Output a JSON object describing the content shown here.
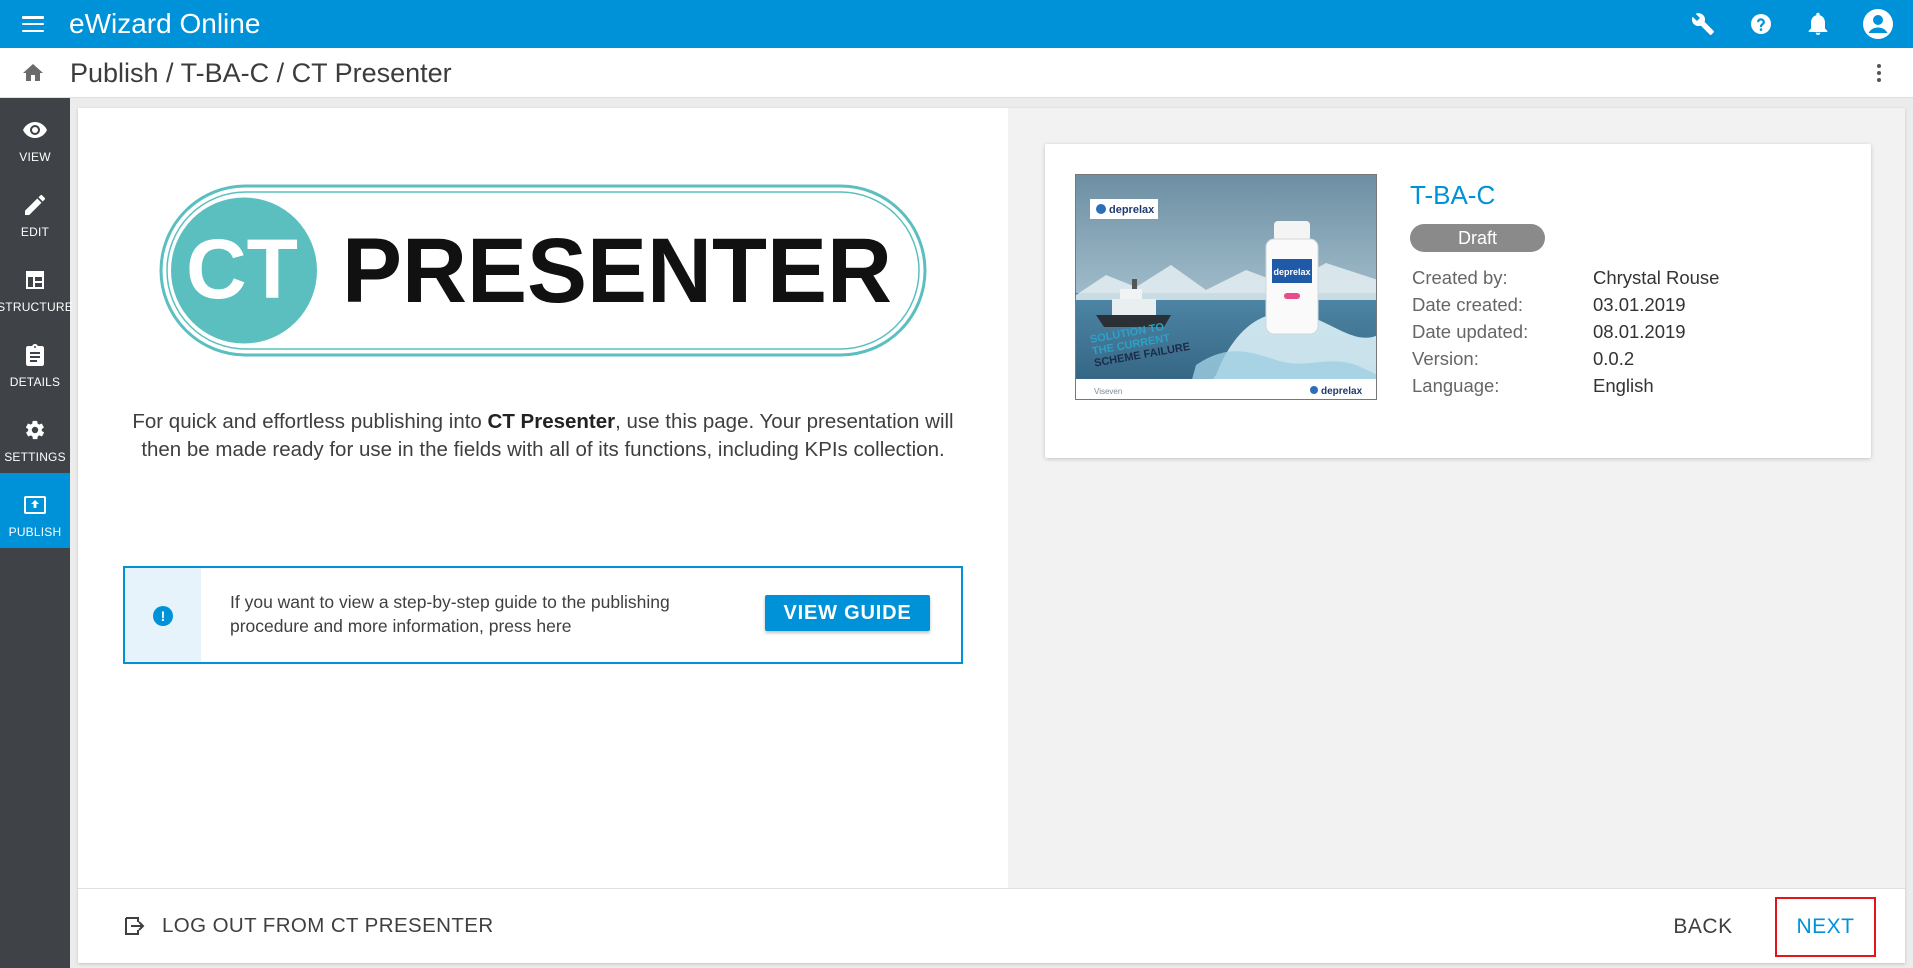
{
  "app": {
    "title": "eWizard Online"
  },
  "topbar": {
    "icons": [
      "menu-icon",
      "wrench-icon",
      "help-icon",
      "bell-icon",
      "account-icon"
    ]
  },
  "breadcrumb": {
    "text": "Publish / T-BA-C / CT Presenter"
  },
  "sidebar": {
    "items": [
      {
        "label": "VIEW",
        "icon": "eye-icon",
        "active": false
      },
      {
        "label": "EDIT",
        "icon": "pencil-icon",
        "active": false
      },
      {
        "label": "STRUCTURE",
        "icon": "structure-icon",
        "active": false
      },
      {
        "label": "DETAILS",
        "icon": "clipboard-icon",
        "active": false
      },
      {
        "label": "SETTINGS",
        "icon": "gear-icon",
        "active": false
      },
      {
        "label": "PUBLISH",
        "icon": "publish-icon",
        "active": true
      }
    ]
  },
  "logo": {
    "badge_text": "CT",
    "word": "PRESENTER"
  },
  "description": {
    "part1": "For quick and effortless publishing into ",
    "bold": "CT Presenter",
    "part2": ", use this page. Your presentation will then be made ready for use in the fields with all of its functions, including KPIs collection."
  },
  "guide": {
    "text": "If you want to view a step-by-step guide to the publishing procedure and more information, press here",
    "button": "VIEW GUIDE"
  },
  "presentation": {
    "title": "T-BA-C",
    "status": "Draft",
    "thumbnail": {
      "brand": "deprelax",
      "tagline_1": "SOLUTION TO",
      "tagline_2": "THE CURRENT",
      "tagline_3": "SCHEME FAILURE",
      "footer_brand": "deprelax",
      "footer_left": "Viseven"
    },
    "meta": [
      {
        "label": "Created by:",
        "value": "Chrystal Rouse"
      },
      {
        "label": "Date created:",
        "value": "03.01.2019"
      },
      {
        "label": "Date updated:",
        "value": "08.01.2019"
      },
      {
        "label": "Version:",
        "value": "0.0.2"
      },
      {
        "label": "Language:",
        "value": "English"
      }
    ]
  },
  "footer": {
    "logout": "LOG OUT FROM CT PRESENTER",
    "back": "BACK",
    "next": "NEXT"
  },
  "colors": {
    "accent": "#0092d8",
    "sidebar_bg": "#3f4246",
    "logo_teal": "#5bbfc0",
    "highlight_red": "#e3141b"
  }
}
